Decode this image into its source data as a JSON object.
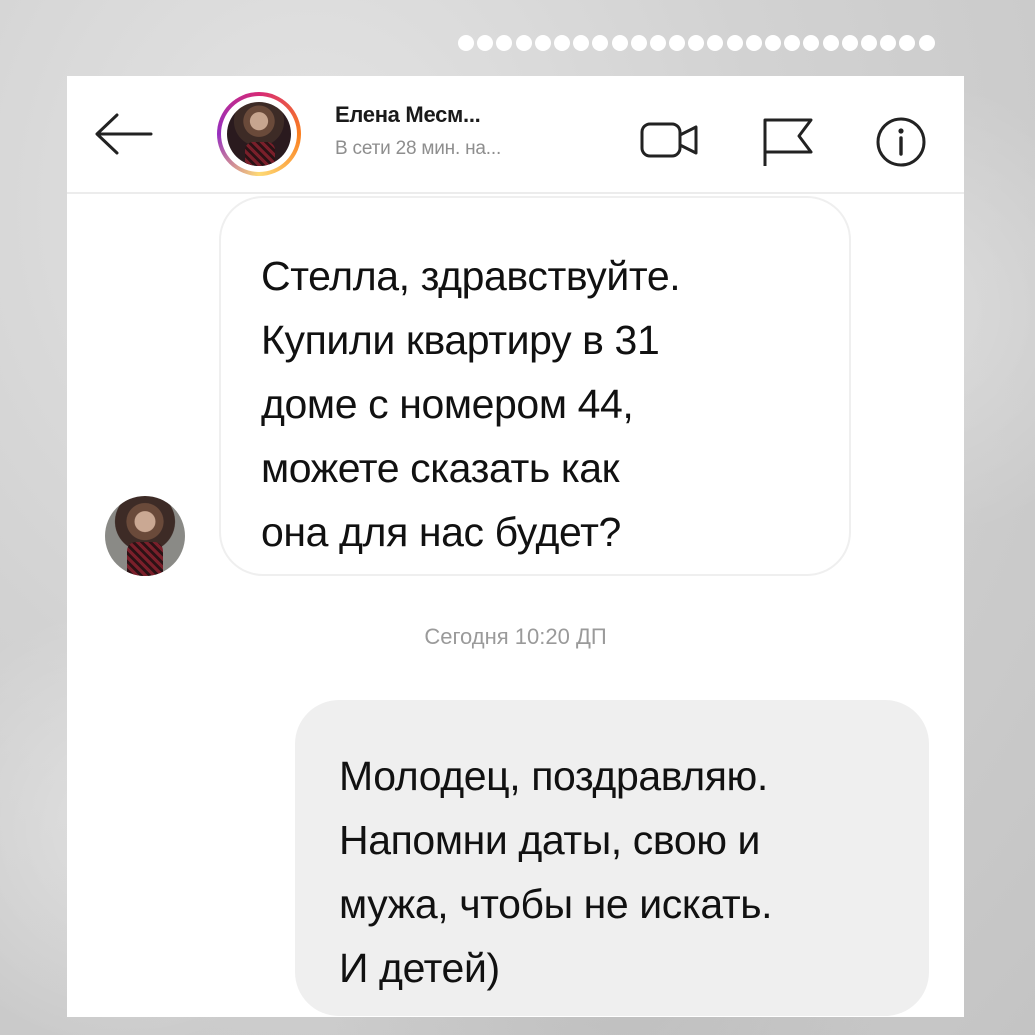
{
  "header": {
    "contact_name": "Елена Месм...",
    "status": "В сети 28 мин. на...",
    "icons": [
      "back-arrow-icon",
      "video-call-icon",
      "flag-icon",
      "info-icon"
    ]
  },
  "messages": [
    {
      "direction": "incoming",
      "text": "Стелла, здравствуйте.\nКупили квартиру в 31\nдоме с номером 44,\nможете сказать как\nона для нас будет?"
    },
    {
      "direction": "outgoing",
      "text": "Молодец, поздравляю.\nНапомни даты, свою и\nмужа, чтобы не искать.\nИ детей)"
    }
  ],
  "timestamp": "Сегодня 10:20 ДП",
  "colors": {
    "story_ring": [
      "#d62976",
      "#fa7e1e",
      "#feda75",
      "#962fbf"
    ],
    "outgoing_bubble": "#efefef",
    "text": "#111111",
    "muted": "#8e8e8e"
  }
}
